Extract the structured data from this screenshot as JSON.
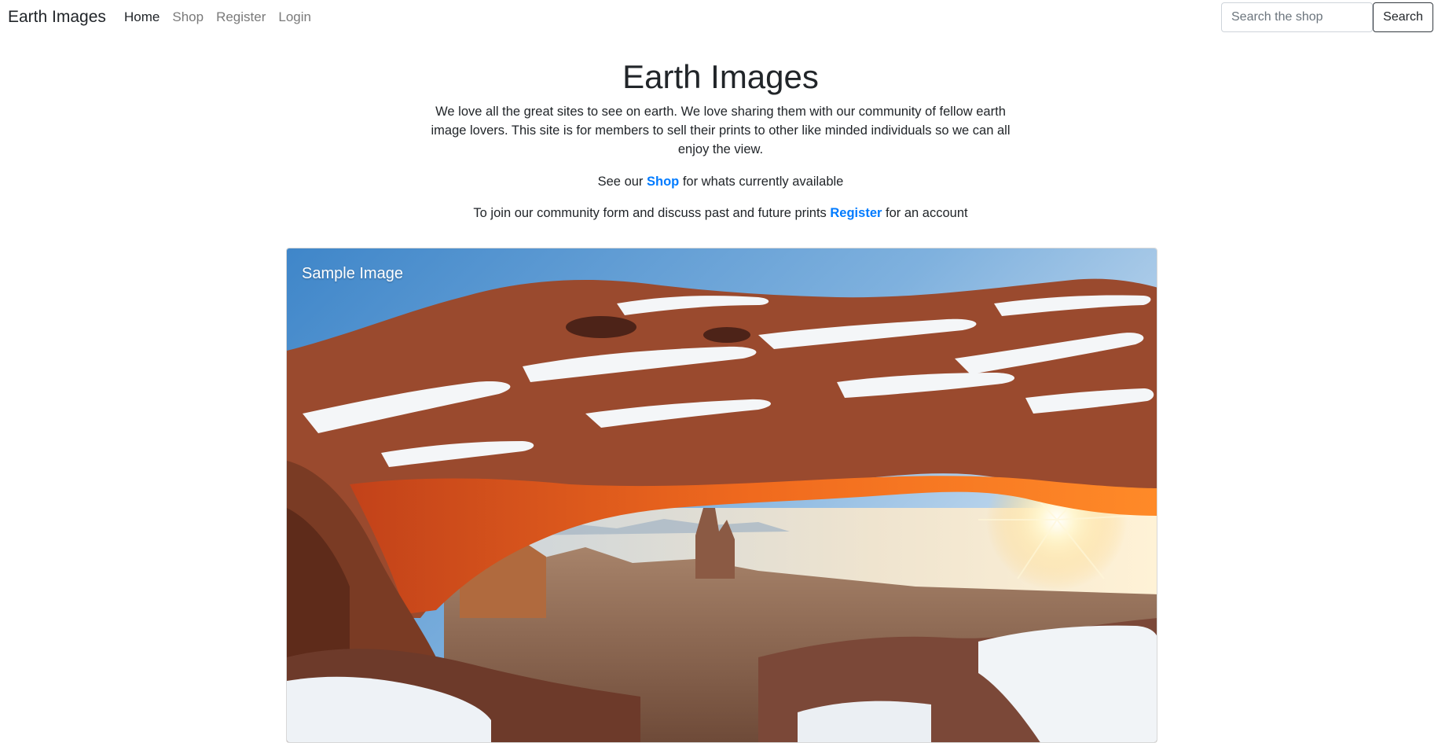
{
  "navbar": {
    "brand": "Earth Images",
    "links": [
      {
        "label": "Home",
        "active": true
      },
      {
        "label": "Shop",
        "active": false
      },
      {
        "label": "Register",
        "active": false
      },
      {
        "label": "Login",
        "active": false
      }
    ],
    "search": {
      "placeholder": "Search the shop",
      "value": "",
      "button_label": "Search"
    }
  },
  "hero": {
    "title": "Earth Images",
    "description": "We love all the great sites to see on earth. We love sharing them with our community of fellow earth image lovers. This site is for members to sell their prints to other like minded individuals so we can all enjoy the view.",
    "shop_line": {
      "before": "See our ",
      "link": "Shop",
      "after": " for whats currently available"
    },
    "register_line": {
      "before": "To join our community form and discuss past and future prints ",
      "link": "Register",
      "after": " for an account"
    }
  },
  "sample_card": {
    "caption": "Sample Image",
    "image_icon": "sunrise-arch-photo"
  },
  "colors": {
    "link": "#007bff",
    "text": "#212529",
    "muted_nav": "#7a7a7a"
  }
}
